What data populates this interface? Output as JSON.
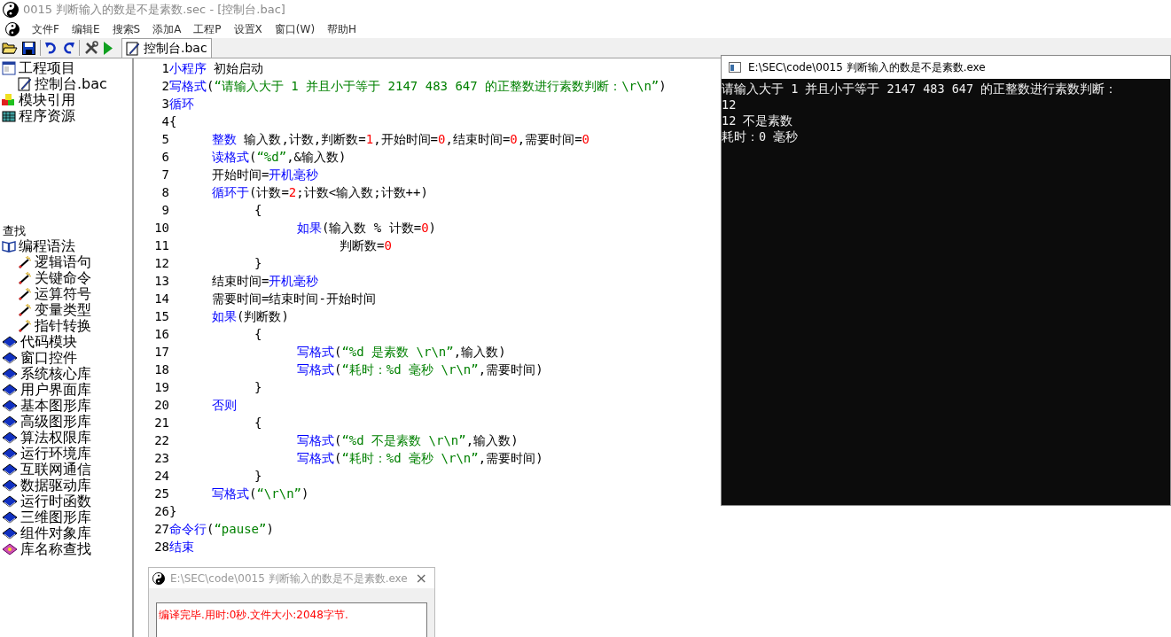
{
  "window": {
    "title": "0015 判断输入的数是不是素数.sec - [控制台.bac]"
  },
  "menu": [
    "文件F",
    "编辑E",
    "搜索S",
    "添加A",
    "工程P",
    "设置X",
    "窗口(W)",
    "帮助H"
  ],
  "tab": {
    "label": "控制台.bac",
    "selected": true
  },
  "project_tree": [
    {
      "label": "工程项目",
      "kind": "window",
      "children": [
        {
          "label": "控制台.bac",
          "kind": "file"
        }
      ]
    },
    {
      "label": "模块引用",
      "kind": "cubes"
    },
    {
      "label": "程序资源",
      "kind": "resource"
    }
  ],
  "search_label": "查找",
  "library_tree": [
    {
      "label": "编程语法",
      "kind": "openbook",
      "children": [
        {
          "label": "逻辑语句",
          "kind": "wand"
        },
        {
          "label": "关键命令",
          "kind": "wand"
        },
        {
          "label": "运算符号",
          "kind": "wand"
        },
        {
          "label": "变量类型",
          "kind": "wand"
        },
        {
          "label": "指针转换",
          "kind": "wand"
        }
      ]
    },
    {
      "label": "代码模块",
      "kind": "book"
    },
    {
      "label": "窗口控件",
      "kind": "book"
    },
    {
      "label": "系统核心库",
      "kind": "book"
    },
    {
      "label": "用户界面库",
      "kind": "book"
    },
    {
      "label": "基本图形库",
      "kind": "book"
    },
    {
      "label": "高级图形库",
      "kind": "book"
    },
    {
      "label": "算法权限库",
      "kind": "book"
    },
    {
      "label": "运行环境库",
      "kind": "book"
    },
    {
      "label": "互联网通信",
      "kind": "book"
    },
    {
      "label": "数据驱动库",
      "kind": "book"
    },
    {
      "label": "运行时函数",
      "kind": "book"
    },
    {
      "label": "三维图形库",
      "kind": "book"
    },
    {
      "label": "组件对象库",
      "kind": "book"
    },
    {
      "label": "库名称查找",
      "kind": "searchbook"
    }
  ],
  "editor": {
    "lines": [
      {
        "number": "1",
        "tokens": [
          {
            "kind": "keyword",
            "text": "小程序"
          },
          {
            "kind": "plain",
            "text": " 初始启动"
          }
        ]
      },
      {
        "number": "2",
        "tokens": [
          {
            "kind": "keyword",
            "text": "写格式"
          },
          {
            "kind": "plain",
            "text": "("
          },
          {
            "kind": "string",
            "text": "“请输入大于 1 并且小于等于 2147 483 647 的正整数进行素数判断：\\r\\n”"
          },
          {
            "kind": "plain",
            "text": ")"
          }
        ]
      },
      {
        "number": "3",
        "tokens": [
          {
            "kind": "keyword",
            "text": "循环"
          }
        ]
      },
      {
        "number": "4",
        "tokens": [
          {
            "kind": "plain",
            "text": "{"
          }
        ],
        "children": [
          {
            "number": "5",
            "tokens": [
              {
                "kind": "keyword",
                "text": "整数"
              },
              {
                "kind": "plain",
                "text": " 输入数,计数,判断数="
              },
              {
                "kind": "number",
                "text": "1"
              },
              {
                "kind": "plain",
                "text": ",开始时间="
              },
              {
                "kind": "number",
                "text": "0"
              },
              {
                "kind": "plain",
                "text": ",结束时间="
              },
              {
                "kind": "number",
                "text": "0"
              },
              {
                "kind": "plain",
                "text": ",需要时间="
              },
              {
                "kind": "number",
                "text": "0"
              }
            ]
          },
          {
            "number": "6",
            "tokens": [
              {
                "kind": "keyword",
                "text": "读格式"
              },
              {
                "kind": "plain",
                "text": "("
              },
              {
                "kind": "string",
                "text": "“%d”"
              },
              {
                "kind": "plain",
                "text": ",&输入数)"
              }
            ]
          },
          {
            "number": "7",
            "tokens": [
              {
                "kind": "plain",
                "text": "开始时间="
              },
              {
                "kind": "keyword",
                "text": "开机毫秒"
              }
            ]
          },
          {
            "number": "8",
            "tokens": [
              {
                "kind": "keyword",
                "text": "循环于"
              },
              {
                "kind": "plain",
                "text": "(计数="
              },
              {
                "kind": "number",
                "text": "2"
              },
              {
                "kind": "plain",
                "text": ";计数<输入数;计数++)"
              }
            ],
            "children": [
              {
                "number": "9",
                "tokens": [
                  {
                    "kind": "plain",
                    "text": "{"
                  }
                ],
                "children": [
                  {
                    "number": "10",
                    "tokens": [
                      {
                        "kind": "keyword",
                        "text": "如果"
                      },
                      {
                        "kind": "plain",
                        "text": "(输入数 % 计数="
                      },
                      {
                        "kind": "number",
                        "text": "0"
                      },
                      {
                        "kind": "plain",
                        "text": ")"
                      }
                    ],
                    "children": [
                      {
                        "number": "11",
                        "tokens": [
                          {
                            "kind": "plain",
                            "text": "判断数="
                          },
                          {
                            "kind": "number",
                            "text": "0"
                          }
                        ]
                      }
                    ]
                  }
                ]
              },
              {
                "number": "12",
                "tokens": [
                  {
                    "kind": "plain",
                    "text": "}"
                  }
                ]
              }
            ]
          },
          {
            "number": "13",
            "tokens": [
              {
                "kind": "plain",
                "text": "结束时间="
              },
              {
                "kind": "keyword",
                "text": "开机毫秒"
              }
            ]
          },
          {
            "number": "14",
            "tokens": [
              {
                "kind": "plain",
                "text": "需要时间=结束时间-开始时间"
              }
            ]
          },
          {
            "number": "15",
            "tokens": [
              {
                "kind": "keyword",
                "text": "如果"
              },
              {
                "kind": "plain",
                "text": "(判断数)"
              }
            ],
            "children": [
              {
                "number": "16",
                "tokens": [
                  {
                    "kind": "plain",
                    "text": "{"
                  }
                ],
                "children": [
                  {
                    "number": "17",
                    "tokens": [
                      {
                        "kind": "keyword",
                        "text": "写格式"
                      },
                      {
                        "kind": "plain",
                        "text": "("
                      },
                      {
                        "kind": "string",
                        "text": "“%d 是素数 \\r\\n”"
                      },
                      {
                        "kind": "plain",
                        "text": ",输入数)"
                      }
                    ]
                  },
                  {
                    "number": "18",
                    "tokens": [
                      {
                        "kind": "keyword",
                        "text": "写格式"
                      },
                      {
                        "kind": "plain",
                        "text": "("
                      },
                      {
                        "kind": "string",
                        "text": "“耗时：%d 毫秒 \\r\\n”"
                      },
                      {
                        "kind": "plain",
                        "text": ",需要时间)"
                      }
                    ]
                  }
                ]
              },
              {
                "number": "19",
                "tokens": [
                  {
                    "kind": "plain",
                    "text": "}"
                  }
                ]
              }
            ]
          },
          {
            "number": "20",
            "tokens": [
              {
                "kind": "keyword",
                "text": "否则"
              }
            ],
            "children": [
              {
                "number": "21",
                "tokens": [
                  {
                    "kind": "plain",
                    "text": "{"
                  }
                ],
                "children": [
                  {
                    "number": "22",
                    "tokens": [
                      {
                        "kind": "keyword",
                        "text": "写格式"
                      },
                      {
                        "kind": "plain",
                        "text": "("
                      },
                      {
                        "kind": "string",
                        "text": "“%d 不是素数 \\r\\n”"
                      },
                      {
                        "kind": "plain",
                        "text": ",输入数)"
                      }
                    ]
                  },
                  {
                    "number": "23",
                    "tokens": [
                      {
                        "kind": "keyword",
                        "text": "写格式"
                      },
                      {
                        "kind": "plain",
                        "text": "("
                      },
                      {
                        "kind": "string",
                        "text": "“耗时：%d 毫秒 \\r\\n”"
                      },
                      {
                        "kind": "plain",
                        "text": ",需要时间)"
                      }
                    ]
                  }
                ]
              },
              {
                "number": "24",
                "tokens": [
                  {
                    "kind": "plain",
                    "text": "}"
                  }
                ]
              }
            ]
          },
          {
            "number": "25",
            "tokens": [
              {
                "kind": "keyword",
                "text": "写格式"
              },
              {
                "kind": "plain",
                "text": "("
              },
              {
                "kind": "string",
                "text": "“\\r\\n”"
              },
              {
                "kind": "plain",
                "text": ")"
              }
            ]
          }
        ]
      },
      {
        "number": "26",
        "tokens": [
          {
            "kind": "plain",
            "text": "}"
          }
        ]
      },
      {
        "number": "27",
        "tokens": [
          {
            "kind": "keyword",
            "text": "命令行"
          },
          {
            "kind": "plain",
            "text": "("
          },
          {
            "kind": "string",
            "text": "“pause”"
          },
          {
            "kind": "plain",
            "text": ")"
          }
        ]
      },
      {
        "number": "28",
        "tokens": [
          {
            "kind": "keyword",
            "text": "结束"
          }
        ]
      }
    ]
  },
  "console": {
    "title": "E:\\SEC\\code\\0015 判断输入的数是不是素数.exe",
    "lines": [
      "请输入大于 1 并且小于等于 2147 483 647 的正整数进行素数判断：",
      "12",
      "12 不是素数",
      "耗时：0 毫秒"
    ]
  },
  "compile_dialog": {
    "title": "E:\\SEC\\code\\0015 判断输入的数是不是素数.exe",
    "close": "×",
    "message": "编译完毕.用时:0秒.文件大小:2048字节."
  }
}
